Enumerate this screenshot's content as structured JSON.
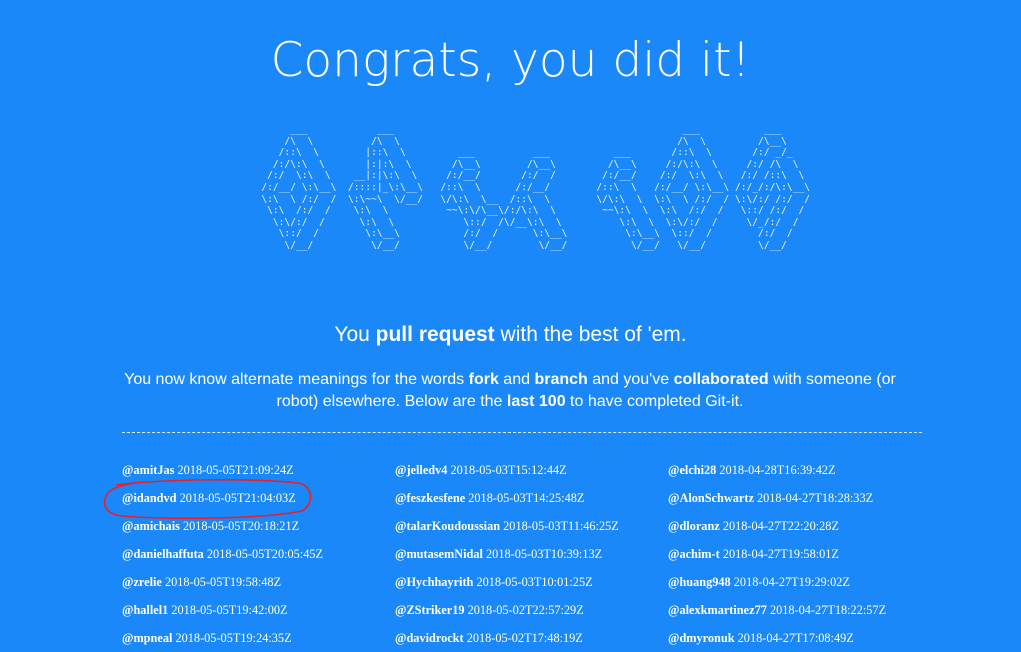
{
  "page": {
    "title": "Congrats, you did it!",
    "ascii_art": "        ___            ___                                                  ___           ___\n       /\\  \\          /\\  \\                                                /\\  \\         /\\__\\\n      /::\\  \\        |::\\  \\         ___          ___           ___       /::\\  \\       /:/ _/_\n     /:/\\:\\  \\       |:|:\\  \\       /\\__\\        /\\__\\         /\\__\\     /:/\\:\\  \\     /:/ /\\  \\\n    /:/  \\:\\  \\    __|:|\\:\\  \\     /:/__/       /:/  /        /:/__/    /:/  \\:\\  \\   /:/ /::\\  \\\n   /:/__/ \\:\\__\\  /::::|_\\:\\__\\   /::\\  \\      /:/__/        /::\\  \\   /:/__/ \\:\\__\\ /:/_/:/\\:\\__\\\n   \\:\\  \\ /:/  /  \\:\\~~\\  \\/__/   \\/\\:\\  \\__  /::\\  \\        \\/\\:\\  \\  \\:\\  \\ /:/  / \\:\\/:/ /:/  /\n    \\:\\  /:/  /    \\:\\  \\          ~~\\:\\/\\__\\/:/\\:\\  \\        ~~\\:\\  \\  \\:\\  /:/  /   \\::/ /:/  /\n     \\:\\/:/  /      \\:\\  \\            \\::/  /\\/__\\:\\  \\          \\:\\  \\  \\:\\/:/  /     \\/_/:/  /\n      \\::/  /        \\:\\__\\           /:/  /      \\:\\__\\          \\:\\__\\  \\::/  /        /:/  /\n       \\/__/          \\/__/           \\/__/        \\/__/           \\/__/   \\/__/         \\/__/",
    "tagline": {
      "pre": "You ",
      "strong": "pull request",
      "post": " with the best of 'em."
    },
    "description": {
      "t1": "You now know alternate meanings for the words ",
      "b1": "fork",
      "t2": " and ",
      "b2": "branch",
      "t3": " and you've ",
      "b3": "collaborated",
      "t4": " with someone (or robot) elsewhere. Below are the ",
      "b4": "last 100",
      "t5": " to have completed Git-it."
    },
    "annotation_color": "#e8202a"
  },
  "completions": {
    "col1": [
      {
        "user": "@amitJas",
        "time": "2018-05-05T21:09:24Z"
      },
      {
        "user": "@idandvd",
        "time": "2018-05-05T21:04:03Z"
      },
      {
        "user": "@amichais",
        "time": "2018-05-05T20:18:21Z"
      },
      {
        "user": "@danielhaffuta",
        "time": "2018-05-05T20:05:45Z"
      },
      {
        "user": "@zrelie",
        "time": "2018-05-05T19:58:48Z"
      },
      {
        "user": "@hallel1",
        "time": "2018-05-05T19:42:00Z"
      },
      {
        "user": "@mpneal",
        "time": "2018-05-05T19:24:35Z"
      }
    ],
    "col2": [
      {
        "user": "@jelledv4",
        "time": "2018-05-03T15:12:44Z"
      },
      {
        "user": "@feszkesfene",
        "time": "2018-05-03T14:25:48Z"
      },
      {
        "user": "@talarKoudoussian",
        "time": "2018-05-03T11:46:25Z"
      },
      {
        "user": "@mutasemNidal",
        "time": "2018-05-03T10:39:13Z"
      },
      {
        "user": "@Hychhayrith",
        "time": "2018-05-03T10:01:25Z"
      },
      {
        "user": "@ZStriker19",
        "time": "2018-05-02T22:57:29Z"
      },
      {
        "user": "@davidrockt",
        "time": "2018-05-02T17:48:19Z"
      }
    ],
    "col3": [
      {
        "user": "@elchi28",
        "time": "2018-04-28T16:39:42Z"
      },
      {
        "user": "@AlonSchwartz",
        "time": "2018-04-27T18:28:33Z"
      },
      {
        "user": "@dloranz",
        "time": "2018-04-27T22:20:28Z"
      },
      {
        "user": "@achim-t",
        "time": "2018-04-27T19:58:01Z"
      },
      {
        "user": "@huang948",
        "time": "2018-04-27T19:29:02Z"
      },
      {
        "user": "@alexkmartinez77",
        "time": "2018-04-27T18:22:57Z"
      },
      {
        "user": "@dmyronuk",
        "time": "2018-04-27T17:08:49Z"
      }
    ]
  }
}
